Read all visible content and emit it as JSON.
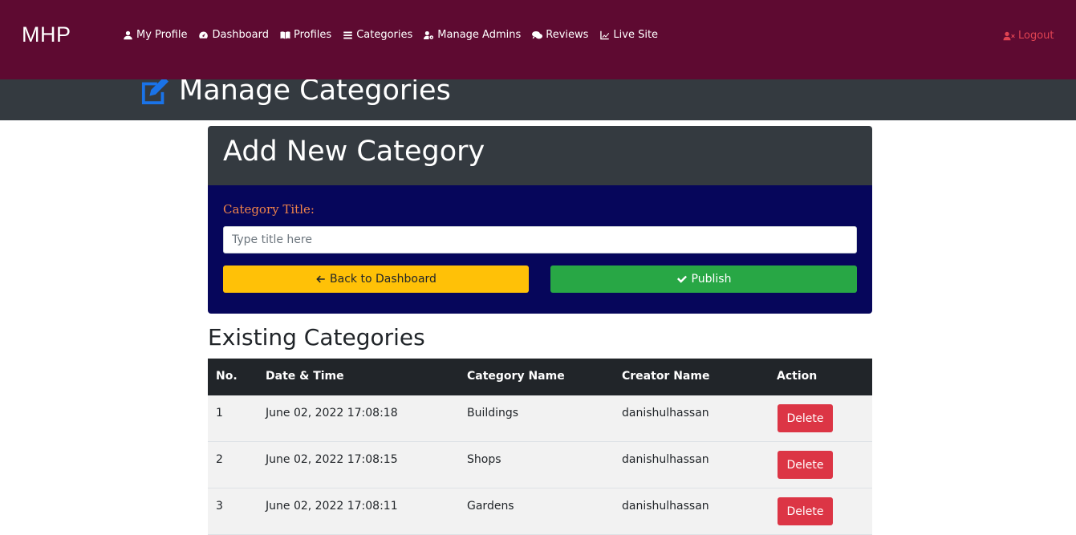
{
  "brand": "MHP",
  "nav": {
    "items": [
      {
        "label": "My Profile",
        "icon": "user-icon"
      },
      {
        "label": "Dashboard",
        "icon": "tachometer-icon"
      },
      {
        "label": "Profiles",
        "icon": "book-open-icon"
      },
      {
        "label": "Categories",
        "icon": "list-icon"
      },
      {
        "label": "Manage Admins",
        "icon": "user-cog-icon"
      },
      {
        "label": "Reviews",
        "icon": "comments-icon"
      },
      {
        "label": "Live Site",
        "icon": "chart-line-icon"
      }
    ],
    "logout": "Logout"
  },
  "header": {
    "title": "Manage Categories",
    "icon": "edit-icon"
  },
  "form": {
    "title": "Add New Category",
    "label": "Category Title:",
    "placeholder": "Type title here",
    "value": "",
    "back_label": "Back to Dashboard",
    "publish_label": "Publish"
  },
  "existing": {
    "title": "Existing Categories",
    "columns": [
      "No.",
      "Date & Time",
      "Category Name",
      "Creator Name",
      "Action"
    ],
    "rows": [
      {
        "no": "1",
        "datetime": "June 02, 2022 17:08:18",
        "name": "Buildings",
        "creator": "danishulhassan",
        "action": "Delete"
      },
      {
        "no": "2",
        "datetime": "June 02, 2022 17:08:15",
        "name": "Shops",
        "creator": "danishulhassan",
        "action": "Delete"
      },
      {
        "no": "3",
        "datetime": "June 02, 2022 17:08:11",
        "name": "Gardens",
        "creator": "danishulhassan",
        "action": "Delete"
      }
    ]
  },
  "colors": {
    "navbar": "#5e0a31",
    "header": "#343a40",
    "form_body": "#06065b",
    "label": "#f0844a",
    "back_button": "#ffc107",
    "publish_button": "#28a745",
    "delete_button": "#dc3545",
    "logout": "#e04352",
    "edit_icon": "#1a73e8"
  }
}
